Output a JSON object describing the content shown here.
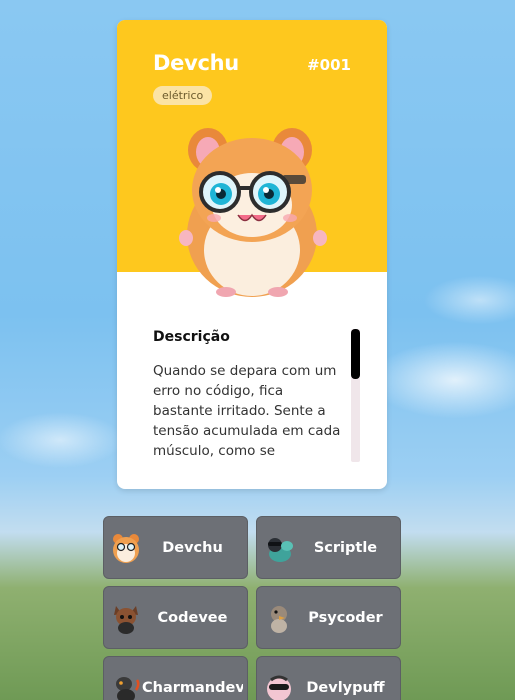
{
  "card": {
    "name": "Devchu",
    "number": "#001",
    "type": "elétrico",
    "header_color": "#fec81e",
    "description": {
      "title": "Descrição",
      "text": "Quando se depara com um erro no código, fica bastante irritado. Sente a tensão acumulada em cada músculo, como se"
    },
    "image_icon": "hamster-with-glasses"
  },
  "list": [
    {
      "label": "Devchu",
      "icon": "hamster-icon"
    },
    {
      "label": "Scriptle",
      "icon": "bulbasaur-icon"
    },
    {
      "label": "Codevee",
      "icon": "fox-icon"
    },
    {
      "label": "Psycoder",
      "icon": "duck-icon"
    },
    {
      "label": "Charmandev",
      "icon": "lizard-icon"
    },
    {
      "label": "Devlypuff",
      "icon": "puffball-icon"
    }
  ]
}
